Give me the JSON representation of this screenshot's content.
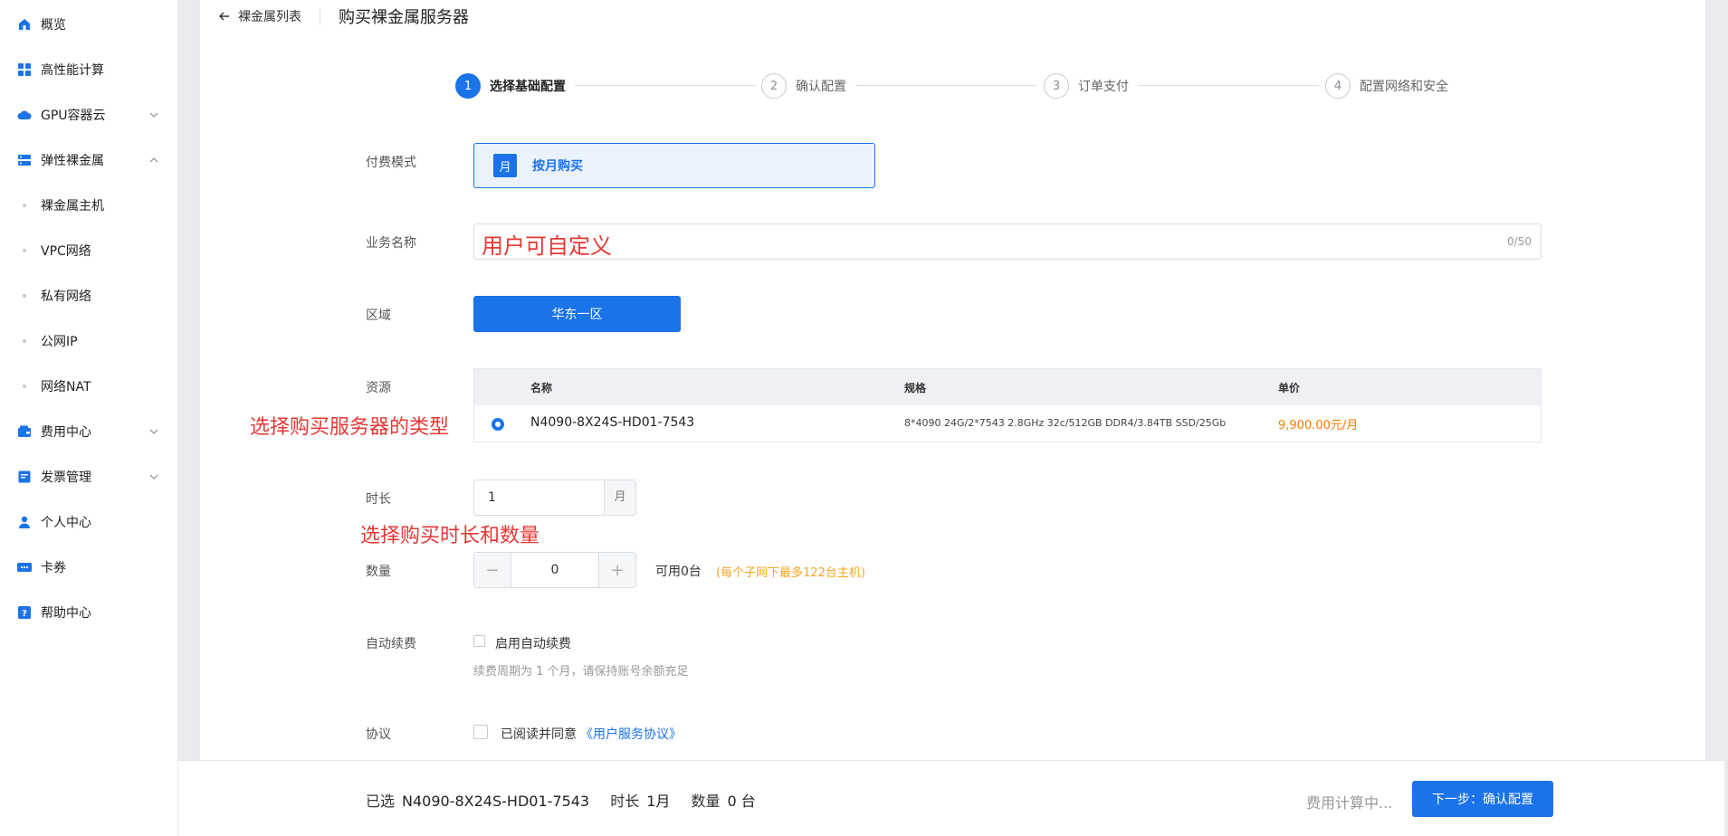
{
  "sidebar": {
    "items": [
      {
        "label": "概览",
        "icon": "home-icon"
      },
      {
        "label": "高性能计算",
        "icon": "grid-icon"
      },
      {
        "label": "GPU容器云",
        "icon": "cloud-icon"
      },
      {
        "label": "弹性裸金属",
        "icon": "server-icon"
      },
      {
        "label": "裸金属主机"
      },
      {
        "label": "VPC网络"
      },
      {
        "label": "私有网络"
      },
      {
        "label": "公网IP"
      },
      {
        "label": "网络NAT"
      },
      {
        "label": "费用中心",
        "icon": "wallet-icon"
      },
      {
        "label": "发票管理",
        "icon": "invoice-icon"
      },
      {
        "label": "个人中心",
        "icon": "user-icon"
      },
      {
        "label": "卡券",
        "icon": "ticket-icon"
      },
      {
        "label": "帮助中心",
        "icon": "help-icon"
      }
    ]
  },
  "header": {
    "back_label": "裸金属列表",
    "title": "购买裸金属服务器"
  },
  "steps": [
    {
      "num": "1",
      "label": "选择基础配置",
      "active": true
    },
    {
      "num": "2",
      "label": "确认配置"
    },
    {
      "num": "3",
      "label": "订单支付"
    },
    {
      "num": "4",
      "label": "配置网络和安全"
    }
  ],
  "form": {
    "billing": {
      "label": "付费模式",
      "badge": "月",
      "option": "按月购买"
    },
    "name": {
      "label": "业务名称",
      "value": "用户可自定义",
      "counter": "0/50"
    },
    "region": {
      "label": "区域",
      "value": "华东一区"
    },
    "resource": {
      "label": "资源",
      "columns": [
        "名称",
        "规格",
        "单价"
      ],
      "row": {
        "name": "N4090-8X24S-HD01-7543",
        "spec": "8*4090 24G/2*7543 2.8GHz 32c/512GB DDR4/3.84TB SSD/25Gb",
        "price": "9,900.00元/月"
      }
    },
    "duration": {
      "label": "时长",
      "value": "1",
      "unit": "月"
    },
    "quantity": {
      "label": "数量",
      "value": "0",
      "minus": "−",
      "plus": "+",
      "available": "可用0台",
      "hint": "(每个子网下最多122台主机)"
    },
    "auto_renew": {
      "label": "自动续费",
      "option": "启用自动续费",
      "hint": "续费周期为 1 个月，请保持账号余额充足"
    },
    "agreement": {
      "label": "协议",
      "prefix": "已阅读并同意",
      "link": "《用户服务协议》"
    }
  },
  "annotations": {
    "type": "选择购买服务器的类型",
    "duration": "选择购买时长和数量"
  },
  "footer": {
    "selected_label": "已选",
    "selected_value": "N4090-8X24S-HD01-7543",
    "duration_label": "时长",
    "duration_value": "1月",
    "quantity_label": "数量",
    "quantity_value": "0 台",
    "calc_text": "费用计算中...",
    "next_button": "下一步：确认配置"
  },
  "colors": {
    "accent": "#1a73e8",
    "price": "#f57c00",
    "annotation": "#e53935"
  }
}
